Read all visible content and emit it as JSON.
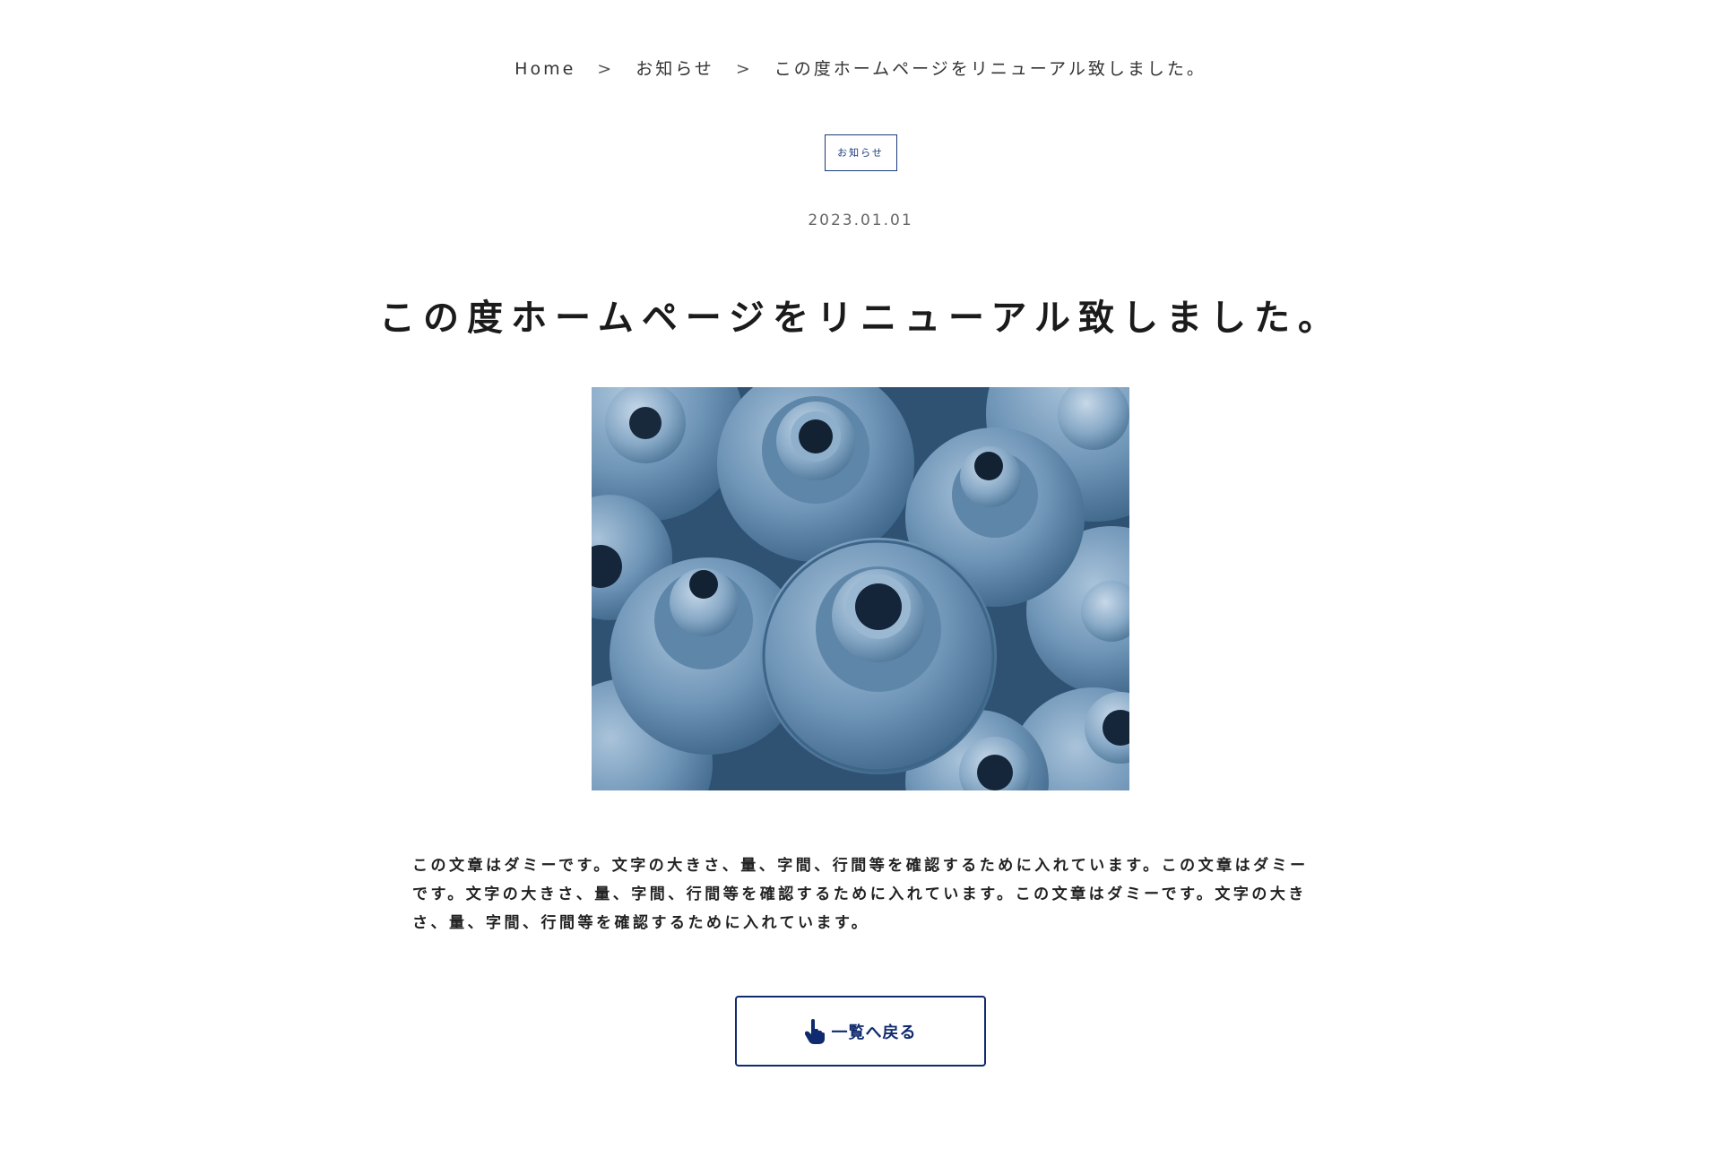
{
  "breadcrumb": {
    "items": [
      "Home",
      "お知らせ",
      "この度ホームページをリニューアル致しました。"
    ],
    "separator": ">"
  },
  "post": {
    "category": "お知らせ",
    "date": "2023.01.01",
    "title": "この度ホームページをリニューアル致しました。",
    "image_icon": "industrial-metal-parts-photo",
    "body": "この文章はダミーです。文字の大きさ、量、字間、行間等を確認するために入れています。この文章はダミーです。文字の大きさ、量、字間、行間等を確認するために入れています。この文章はダミーです。文字の大きさ、量、字間、行間等を確認するために入れています。"
  },
  "actions": {
    "back_label": "一覧へ戻る",
    "back_icon": "pointing-hand-icon"
  },
  "colors": {
    "accent": "#0f2a6e",
    "badge": "#1a3a7a",
    "photo_tint": "#4a7397"
  }
}
